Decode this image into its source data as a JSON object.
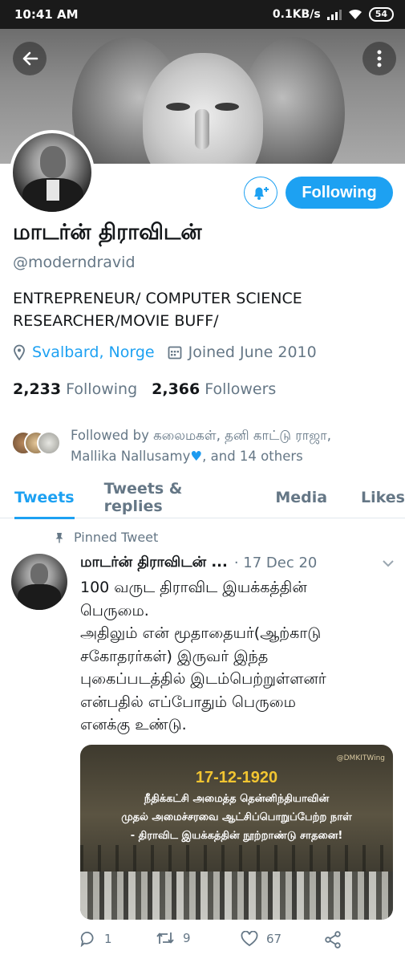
{
  "status_bar": {
    "time": "10:41 AM",
    "net_speed": "0.1KB/s",
    "battery": "54"
  },
  "profile": {
    "display_name": "மாடர்ன் திராவிடன்",
    "handle": "@moderndravid",
    "follow_button": "Following",
    "bio_line1": "ENTREPRENEUR/ COMPUTER SCIENCE",
    "bio_line2": "RESEARCHER/MOVIE BUFF/",
    "location": "Svalbard, Norge",
    "joined": "Joined June 2010",
    "following_count": "2,233",
    "following_label": "Following",
    "followers_count": "2,366",
    "followers_label": "Followers",
    "followed_by_line1": "Followed by கலைமகள், தனி காட்டு ராஜா,",
    "followed_by_line2a": "Mallika Nallusamy",
    "followed_by_line2b": ", and 14 others"
  },
  "tabs": [
    "Tweets",
    "Tweets & replies",
    "Media",
    "Likes"
  ],
  "tweet": {
    "pinned_label": "Pinned Tweet",
    "author": "மாடர்ன் திராவிடன் ...",
    "date": "· 17 Dec 20",
    "text": "100 வருட திராவிட இயக்கத்தின்\nபெருமை.\nஅதிலும் என் மூதாதையர்(ஆற்காடு\nசகோதரர்கள்) இருவர் இந்த\nபுகைப்படத்தில் இடம்பெற்றுள்ளனர்\nஎன்பதில் எப்போதும் பெருமை\nஎனக்கு உண்டு.",
    "media": {
      "watermark": "@DMKITWing",
      "date": "17-12-1920",
      "line1": "நீதிக்கட்சி அமைத்த தென்னிந்தியாவின்",
      "line2": "முதல் அமைச்சரவை ஆட்சிப்பொறுப்பேற்ற நாள்",
      "line3": "- திராவிட இயக்கத்தின் நூற்றாண்டு சாதனை!"
    },
    "replies": "1",
    "retweets": "9",
    "likes": "67"
  },
  "colors": {
    "accent": "#1da1f2",
    "secondary_text": "#657786",
    "primary_text": "#14171a"
  }
}
